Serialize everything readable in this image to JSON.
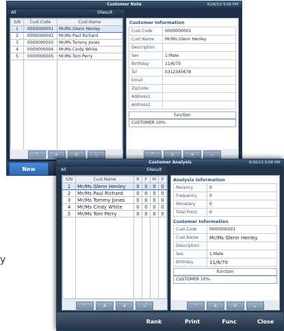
{
  "note": {
    "title": "Customer Note",
    "datetime": "6/26/12 9:06 PM",
    "filter": "All",
    "result": "5Result",
    "list_headers": [
      "S/N",
      "Cust.Code",
      "Cust.Name"
    ],
    "rows": [
      {
        "sn": "1",
        "code": "0000000001",
        "name": "Mr/Ms Glenn Henley"
      },
      {
        "sn": "2",
        "code": "0000000002",
        "name": "Mr/Ms Paul Richard"
      },
      {
        "sn": "3",
        "code": "0000000003",
        "name": "Mr/Ms Tommy Jones"
      },
      {
        "sn": "4",
        "code": "0000000004",
        "name": "Mr/Ms Cindy White"
      },
      {
        "sn": "5",
        "code": "0000000005",
        "name": "Mr/Ms Tom Perry"
      }
    ],
    "info_title": "Customer Information",
    "fields": [
      {
        "k": "Cust.Code",
        "v": "0000000001"
      },
      {
        "k": "Cust.Name",
        "v": "Mr/Ms Glenn Henley"
      },
      {
        "k": "Description",
        "v": ""
      },
      {
        "k": "Sex",
        "v": "1:Male"
      },
      {
        "k": "Birthday",
        "v": "11/6/70"
      },
      {
        "k": "Tel",
        "v": "0312345678"
      },
      {
        "k": "Email",
        "v": ""
      },
      {
        "k": "ZipCode",
        "v": ""
      },
      {
        "k": "Address1",
        "v": ""
      },
      {
        "k": "Address2",
        "v": ""
      }
    ],
    "function_label": "function",
    "function_value": "CUSTOMER 10%-",
    "new_button": "New"
  },
  "nav": {
    "first": "⌃",
    "up": "∧",
    "down": "∨",
    "last": "⌄"
  },
  "analysis": {
    "title": "Customer Analysis",
    "datetime": "6/26/12 9:06 PM",
    "filter": "All",
    "result": "5Result",
    "list_headers": [
      "S/N",
      "Cust.Name",
      "R",
      "F",
      "M",
      "P"
    ],
    "rows": [
      {
        "sn": "1",
        "name": "Mr/Ms Glenn Henley",
        "r": "0",
        "f": "0",
        "m": "0",
        "p": "0"
      },
      {
        "sn": "2",
        "name": "Mr/Ms Paul Richard",
        "r": "0",
        "f": "0",
        "m": "0",
        "p": "0"
      },
      {
        "sn": "3",
        "name": "Mr/Ms Tommy Jones",
        "r": "0",
        "f": "0",
        "m": "0",
        "p": "0"
      },
      {
        "sn": "4",
        "name": "Mr/Ms Cindy White",
        "r": "0",
        "f": "0",
        "m": "0",
        "p": "0"
      },
      {
        "sn": "5",
        "name": "Mr/Ms Tom Perry",
        "r": "0",
        "f": "0",
        "m": "0",
        "p": "0"
      }
    ],
    "analysis_title": "Analysis Information",
    "analysis_fields": [
      {
        "k": "Recency",
        "v": "0"
      },
      {
        "k": "Frequency",
        "v": "0"
      },
      {
        "k": "Monetary",
        "v": "0"
      },
      {
        "k": "Total Point",
        "v": "0"
      }
    ],
    "info_title": "Customer Information",
    "fields": [
      {
        "k": "Cust.Code",
        "v": "0000000001"
      },
      {
        "k": "Cust.Name",
        "v": "Mr/Ms Glenn Henley"
      },
      {
        "k": "Description",
        "v": ""
      },
      {
        "k": "Sex",
        "v": "1:Male"
      },
      {
        "k": "Birthday",
        "v": "11/6/70"
      }
    ],
    "function_label": "function",
    "function_value": "CUSTOMER 10%-",
    "buttons": {
      "rank": "Rank",
      "print": "Print",
      "func": "Func",
      "close": "Close"
    }
  },
  "colors": {
    "accent_blue": "#2e6fc0",
    "dark_bar": "#233449"
  }
}
